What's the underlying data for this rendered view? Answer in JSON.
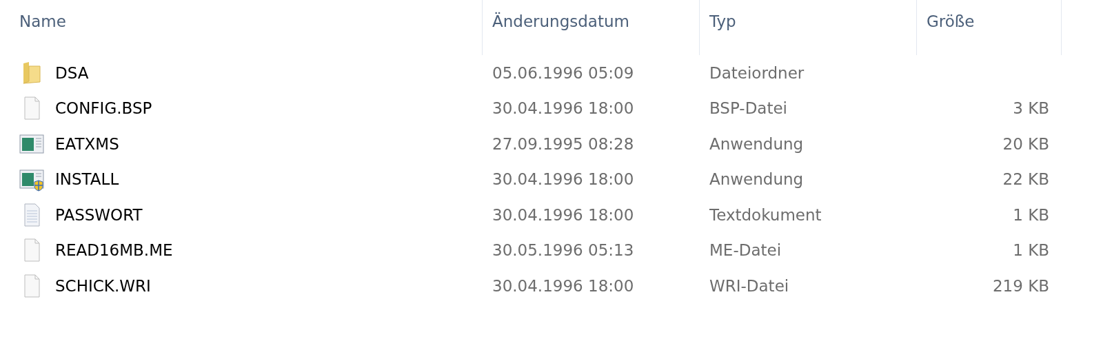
{
  "table": {
    "columns": [
      "Name",
      "Änderungsdatum",
      "Typ",
      "Größe"
    ],
    "rows": [
      {
        "kind": "folder",
        "name": "DSA",
        "date": "05.06.1996 05:09",
        "type": "Dateiordner"
      },
      {
        "kind": "file",
        "name": "CONFIG.BSP",
        "date": "30.04.1996 18:00",
        "type": "BSP-Datei",
        "size": "3 KB"
      },
      {
        "kind": "app",
        "name": "EATXMS",
        "date": "27.09.1995 08:28",
        "type": "Anwendung",
        "size": "20 KB"
      },
      {
        "kind": "installer",
        "name": "INSTALL",
        "date": "30.04.1996 18:00",
        "type": "Anwendung",
        "size": "22 KB"
      },
      {
        "kind": "text",
        "name": "PASSWORT",
        "date": "30.04.1996 18:00",
        "type": "Textdokument",
        "size": "1 KB"
      },
      {
        "kind": "file",
        "name": "READ16MB.ME",
        "date": "30.05.1996 05:13",
        "type": "ME-Datei",
        "size": "1 KB"
      },
      {
        "kind": "file",
        "name": "SCHICK.WRI",
        "date": "30.04.1996 18:00",
        "type": "WRI-Datei",
        "size": "219 KB"
      }
    ]
  }
}
